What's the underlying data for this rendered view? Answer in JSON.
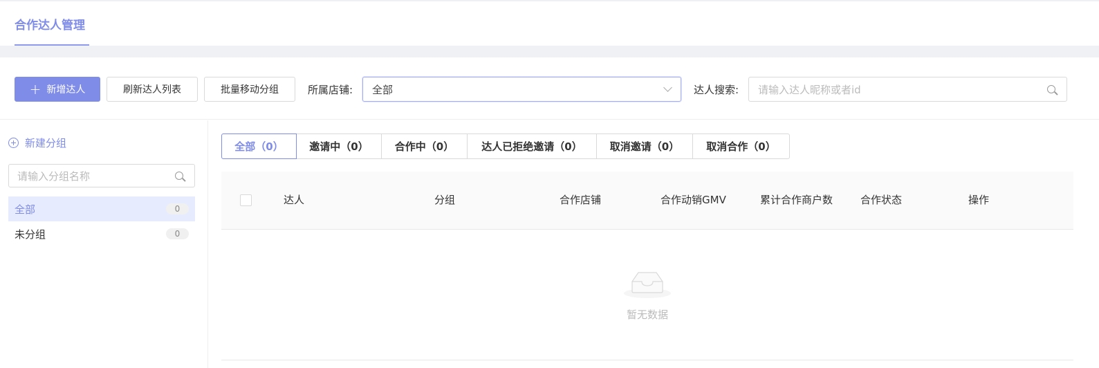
{
  "header": {
    "tab_title": "合作达人管理"
  },
  "toolbar": {
    "add_button": "新增达人",
    "refresh_button": "刷新达人列表",
    "batch_move_button": "批量移动分组",
    "shop_label": "所属店铺:",
    "shop_value": "全部",
    "search_label": "达人搜索:",
    "search_placeholder": "请输入达人昵称或者id"
  },
  "sidebar": {
    "new_group": "新建分组",
    "group_search_placeholder": "请输入分组名称",
    "groups": [
      {
        "label": "全部",
        "count": "0",
        "active": true
      },
      {
        "label": "未分组",
        "count": "0",
        "active": false
      }
    ]
  },
  "status_tabs": [
    {
      "label": "全部（0）",
      "active": true
    },
    {
      "label": "邀请中（0）",
      "active": false
    },
    {
      "label": "合作中（0）",
      "active": false
    },
    {
      "label": "达人已拒绝邀请（0）",
      "active": false
    },
    {
      "label": "取消邀请（0）",
      "active": false
    },
    {
      "label": "取消合作（0）",
      "active": false
    }
  ],
  "table": {
    "columns": [
      "达人",
      "分组",
      "合作店铺",
      "合作动销GMV",
      "累计合作商户数",
      "合作状态",
      "操作"
    ],
    "empty_text": "暂无数据"
  },
  "colors": {
    "accent": "#7f8ce8",
    "active_bg": "#e6ebfd"
  },
  "icons": {
    "add": "plus-icon",
    "dropdown": "chevron-down-icon",
    "search": "search-icon",
    "new_group": "circle-plus-icon",
    "empty": "empty-inbox-icon"
  }
}
